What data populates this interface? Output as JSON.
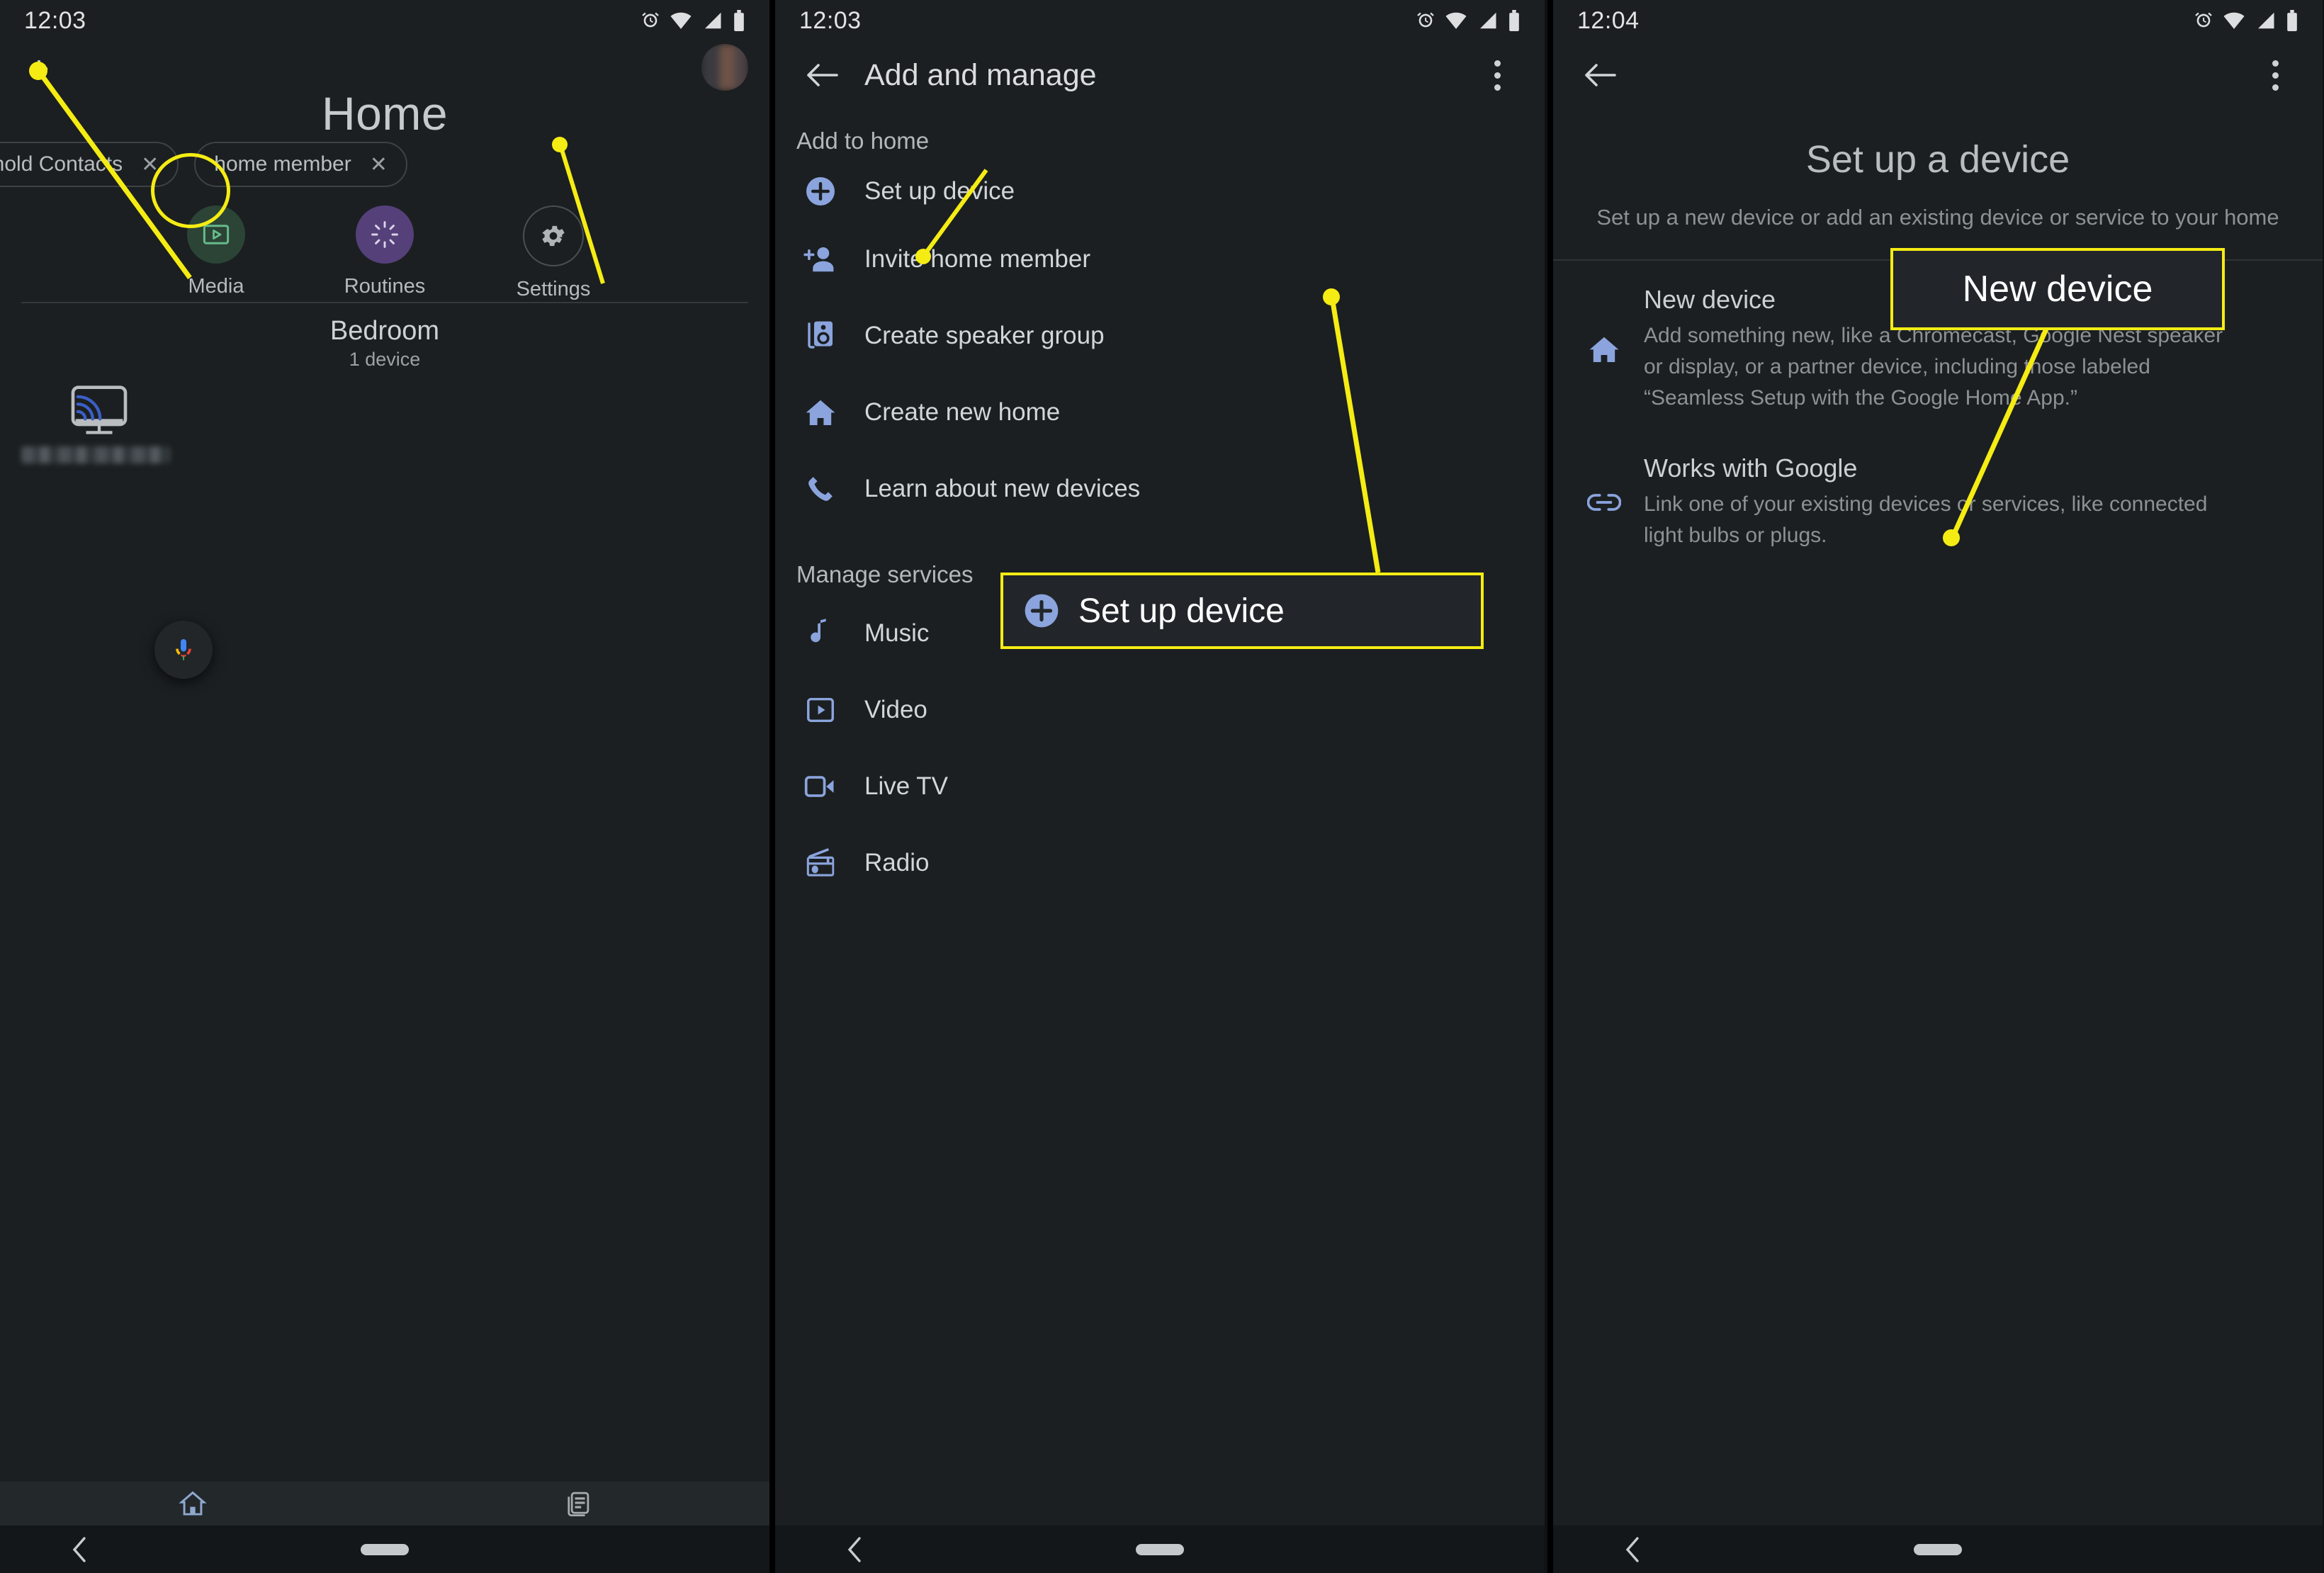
{
  "panel1": {
    "status": {
      "time": "12:03",
      "icons": [
        "alarm-icon",
        "wifi-icon",
        "signal-icon",
        "battery-icon"
      ]
    },
    "add_button": "+",
    "title": "Home",
    "chips": [
      {
        "label": "sehold Contacts",
        "close": "✕"
      },
      {
        "label": "home member",
        "close": "✕"
      }
    ],
    "quick_actions": [
      {
        "label": "Media",
        "icon": "media-play-icon"
      },
      {
        "label": "Routines",
        "icon": "routines-icon"
      },
      {
        "label": "Settings",
        "icon": "gear-icon"
      }
    ],
    "room": {
      "name": "Bedroom",
      "count": "1 device",
      "device_icon": "cast-screen-icon"
    },
    "mic_fab": "google-assistant-mic-icon",
    "bottom_nav": [
      {
        "icon": "home-icon",
        "active": true
      },
      {
        "icon": "feed-icon",
        "active": false
      }
    ],
    "sys_nav": {
      "back": "back-chevron-icon",
      "pill": "home-pill"
    }
  },
  "panel2": {
    "status": {
      "time": "12:03"
    },
    "appbar": {
      "back": "back-arrow-icon",
      "title": "Add and manage",
      "overflow": "overflow-menu-icon"
    },
    "sections": [
      {
        "header": "Add to home",
        "items": [
          {
            "label": "Set up device",
            "icon": "plus-circle-icon"
          },
          {
            "label": "Invite home member",
            "icon": "person-add-icon"
          },
          {
            "label": "Create speaker group",
            "icon": "speaker-icon"
          },
          {
            "label": "Create new home",
            "icon": "home-filled-icon"
          },
          {
            "label": "Learn about new devices",
            "icon": "phone-icon"
          }
        ]
      },
      {
        "header": "Manage services",
        "items": [
          {
            "label": "Music",
            "icon": "music-note-icon"
          },
          {
            "label": "Video",
            "icon": "video-play-icon"
          },
          {
            "label": "Live TV",
            "icon": "live-tv-icon"
          },
          {
            "label": "Radio",
            "icon": "radio-icon"
          }
        ]
      }
    ],
    "sys_nav": {
      "back": "back-chevron-icon",
      "pill": "home-pill"
    }
  },
  "panel3": {
    "status": {
      "time": "12:04"
    },
    "appbar": {
      "back": "back-arrow-icon",
      "title": "",
      "overflow": "overflow-menu-icon"
    },
    "title": "Set up a device",
    "subtitle": "Set up a new device or add an existing device or service to your home",
    "options": [
      {
        "icon": "home-filled-icon",
        "heading": "New device",
        "body": "Add something new, like a Chromecast, Google Nest speaker or display, or a partner device, including those labeled “Seamless Setup with the Google Home App.”"
      },
      {
        "icon": "link-icon",
        "heading": "Works with Google",
        "body": "Link one of your existing devices or services, like connected light bulbs or plugs."
      }
    ],
    "sys_nav": {
      "back": "back-chevron-icon",
      "pill": "home-pill"
    }
  },
  "annotations": {
    "accent_color": "#f5ec14",
    "callout_setup_device": {
      "label": "Set up device",
      "icon": "plus-circle-icon"
    },
    "callout_new_device": {
      "label": "New device"
    },
    "highlight_circle_plus": "add-button-highlight"
  }
}
